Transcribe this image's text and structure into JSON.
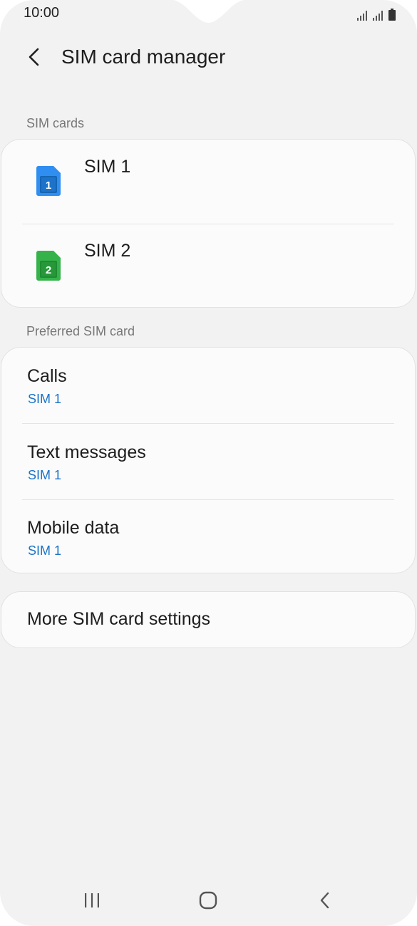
{
  "status_bar": {
    "time": "10:00"
  },
  "header": {
    "title": "SIM card manager",
    "back_icon": "chevron-left-icon"
  },
  "sim_cards_section": {
    "title": "SIM cards",
    "items": [
      {
        "label": "SIM 1",
        "badge": "1",
        "icon": "sim-card-icon",
        "color": "#2f8ef0"
      },
      {
        "label": "SIM 2",
        "badge": "2",
        "icon": "sim-card-icon",
        "color": "#35b34a"
      }
    ]
  },
  "preferred_section": {
    "title": "Preferred SIM card",
    "items": [
      {
        "title": "Calls",
        "value": "SIM 1"
      },
      {
        "title": "Text messages",
        "value": "SIM 1"
      },
      {
        "title": "Mobile data",
        "value": "SIM 1"
      }
    ]
  },
  "more_settings": {
    "label": "More SIM card settings"
  },
  "colors": {
    "accent": "#1a73c9",
    "background": "#f2f2f2",
    "card": "#fbfbfb"
  },
  "nav_bar": {
    "icons": [
      "recent-apps-icon",
      "home-icon",
      "back-icon"
    ]
  }
}
